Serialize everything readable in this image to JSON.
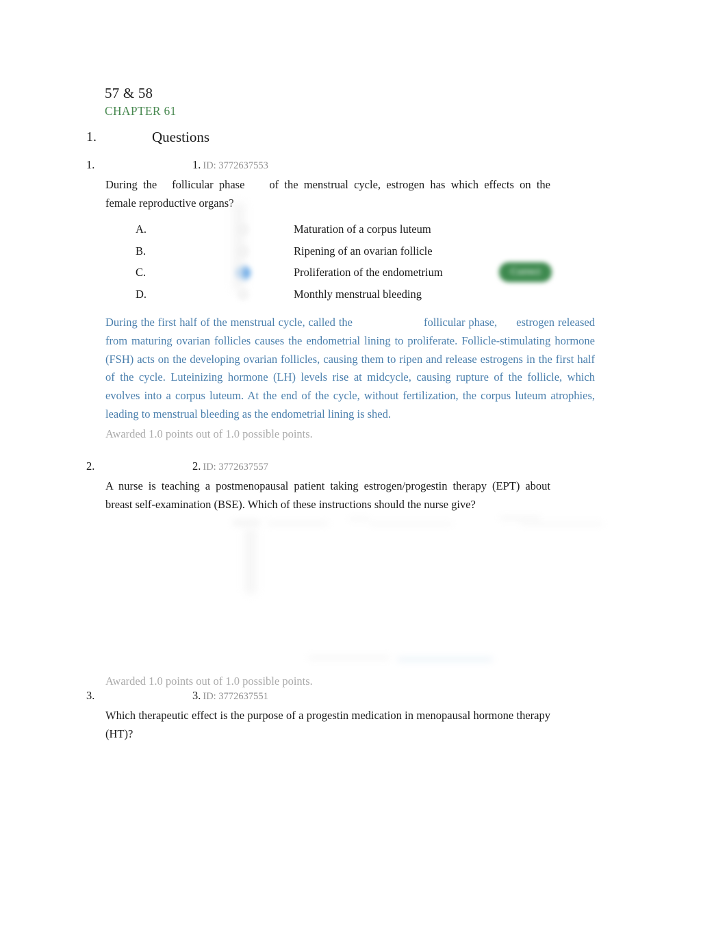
{
  "document": {
    "title": "57 & 58",
    "chapter": "CHAPTER 61"
  },
  "section": {
    "number": "1.",
    "title": "Questions"
  },
  "questions": [
    {
      "outer_number": "1.",
      "inner_number": "1.",
      "id_label": "ID: 3772637553",
      "text_part1": "During the",
      "text_emphasis": "follicular phase",
      "text_part2": "of the menstrual cycle, estrogen has which effects on the female reproductive organs?",
      "options": [
        {
          "letter": "A.",
          "text": "Maturation of a corpus luteum",
          "selected": false
        },
        {
          "letter": "B.",
          "text": "Ripening of an ovarian follicle",
          "selected": false
        },
        {
          "letter": "C.",
          "text": "Proliferation of the endometrium",
          "selected": true,
          "badge": "Correct"
        },
        {
          "letter": "D.",
          "text": "Monthly menstrual bleeding",
          "selected": false
        }
      ],
      "explanation_part1": "During the first half of the menstrual cycle, called the",
      "explanation_emphasis": "follicular phase,",
      "explanation_part2": "estrogen released from maturing ovarian follicles causes the endometrial lining to proliferate. Follicle-stimulating hormone (FSH) acts on the developing ovarian follicles, causing them to ripen and release estrogens in the first half of the cycle. Luteinizing hormone (LH) levels rise at midcycle, causing rupture of the follicle, which evolves into a corpus luteum. At the end of the cycle, without fertilization, the corpus luteum atrophies, leading to menstrual bleeding as the endometrial lining is shed.",
      "awarded": "Awarded 1.0 points out of 1.0 possible points."
    },
    {
      "outer_number": "2.",
      "inner_number": "2.",
      "id_label": "ID: 3772637557",
      "text": "A nurse is teaching a postmenopausal patient taking estrogen/progestin therapy (EPT) about breast self-examination (BSE). Which of these instructions should the nurse give?",
      "awarded": "Awarded 1.0 points out of 1.0 possible points."
    },
    {
      "outer_number": "3.",
      "inner_number": "3.",
      "id_label": "ID: 3772637551",
      "text": "Which therapeutic effect is the purpose of a progestin medication in menopausal hormone therapy (HT)?"
    }
  ],
  "colors": {
    "chapter_green": "#4a8a52",
    "explanation_blue": "#4a7fad",
    "awarded_gray": "#ababab",
    "id_gray": "#8f8f8f",
    "selected_radio_blue": "#2f86dd",
    "correct_badge_green": "#3e8a4f",
    "body_text": "#1a1a1a"
  }
}
